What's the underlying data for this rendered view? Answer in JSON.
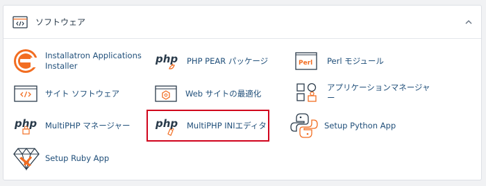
{
  "section": {
    "title": "ソフトウェア",
    "header_icon": "code-window-icon",
    "collapse_icon": "chevron-up-icon"
  },
  "items": [
    {
      "label": "Installatron Applications Installer",
      "label_line1": "Installatron Applications",
      "label_line2": "Installer",
      "icon": "installatron-icon"
    },
    {
      "label": "PHP PEAR パッケージ",
      "icon": "php-pear-icon",
      "icon_text": "php"
    },
    {
      "label": "Perl モジュール",
      "icon": "perl-module-icon",
      "icon_text": "Perl"
    },
    {
      "label": "サイト ソフトウェア",
      "icon": "site-software-icon"
    },
    {
      "label": "Web サイトの最適化",
      "icon": "website-optimization-icon"
    },
    {
      "label": "アプリケーションマネージャー",
      "label_line1": "アプリケーションマネージャ",
      "label_line2": "ー",
      "icon": "application-manager-icon"
    },
    {
      "label": "MultiPHP マネージャー",
      "icon": "multiphp-manager-icon",
      "icon_text": "php"
    },
    {
      "label": "MultiPHP INIエディタ",
      "icon": "multiphp-ini-editor-icon",
      "icon_text": "php",
      "highlighted": true
    },
    {
      "label": "Setup Python App",
      "icon": "python-icon"
    },
    {
      "label": "Setup Ruby App",
      "icon": "ruby-icon"
    }
  ],
  "colors": {
    "accent_orange": "#f26d21",
    "link_blue": "#1f4e79",
    "highlight_red": "#d0021b"
  }
}
